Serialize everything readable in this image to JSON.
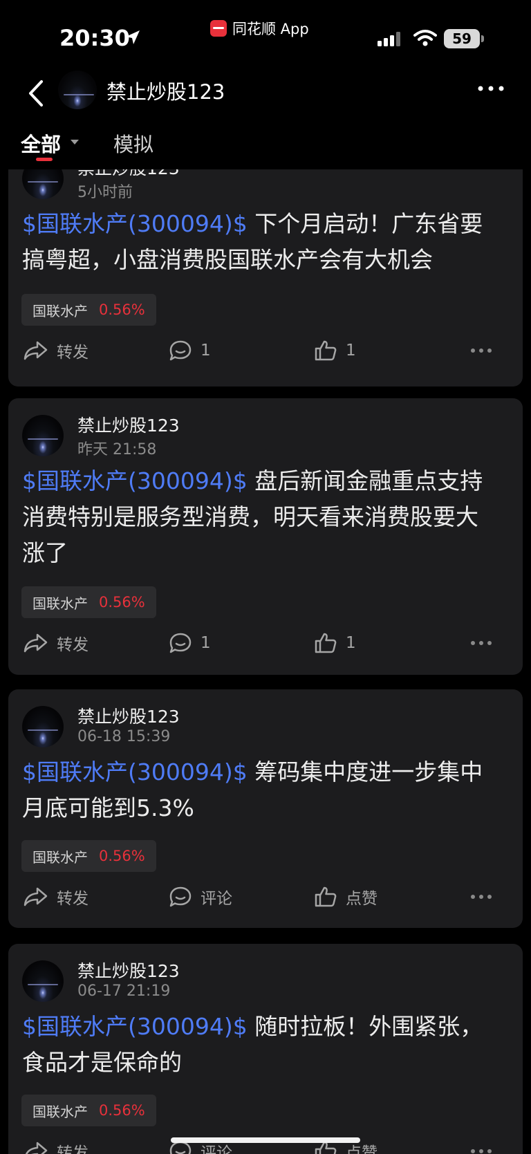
{
  "status_bar": {
    "time": "20:30",
    "app_name": "同花顺 App",
    "battery": "59"
  },
  "nav": {
    "title": "禁止炒股123"
  },
  "tabs": {
    "all": "全部",
    "simulate": "模拟"
  },
  "posts": [
    {
      "author": "禁止炒股123",
      "time": "5小时前",
      "tag": "$国联水产(300094)$",
      "text_lines": [
        " 下个月启动！广东省要",
        "搞粤超，小盘消费股国联水产会有大机会"
      ],
      "stock_name": "国联水产",
      "stock_change": "0.56%",
      "share": "转发",
      "comment": "1",
      "like": "1"
    },
    {
      "author": "禁止炒股123",
      "time": "昨天 21:58",
      "tag": "$国联水产(300094)$",
      "text_lines": [
        " 盘后新闻金融重点支持",
        "消费特别是服务型消费，明天看来消费股要大",
        "涨了"
      ],
      "stock_name": "国联水产",
      "stock_change": "0.56%",
      "share": "转发",
      "comment": "1",
      "like": "1"
    },
    {
      "author": "禁止炒股123",
      "time": "06-18 15:39",
      "tag": "$国联水产(300094)$",
      "text_lines": [
        " 筹码集中度进一步集中",
        "月底可能到5.3%"
      ],
      "stock_name": "国联水产",
      "stock_change": "0.56%",
      "share": "转发",
      "comment": "评论",
      "like": "点赞"
    },
    {
      "author": "禁止炒股123",
      "time": "06-17 21:19",
      "tag": "$国联水产(300094)$",
      "text_lines": [
        " 随时拉板！外围紧张，",
        "食品才是保命的"
      ],
      "stock_name": "国联水产",
      "stock_change": "0.56%",
      "share": "转发",
      "comment": "评论",
      "like": "点赞"
    }
  ],
  "colors": {
    "accent_red": "#e8313b",
    "link_blue": "#4f7cf7",
    "card_bg": "#1c1c1e"
  },
  "icons": [
    "back-arrow-icon",
    "more-dots-icon",
    "share-icon",
    "comment-icon",
    "like-icon"
  ]
}
